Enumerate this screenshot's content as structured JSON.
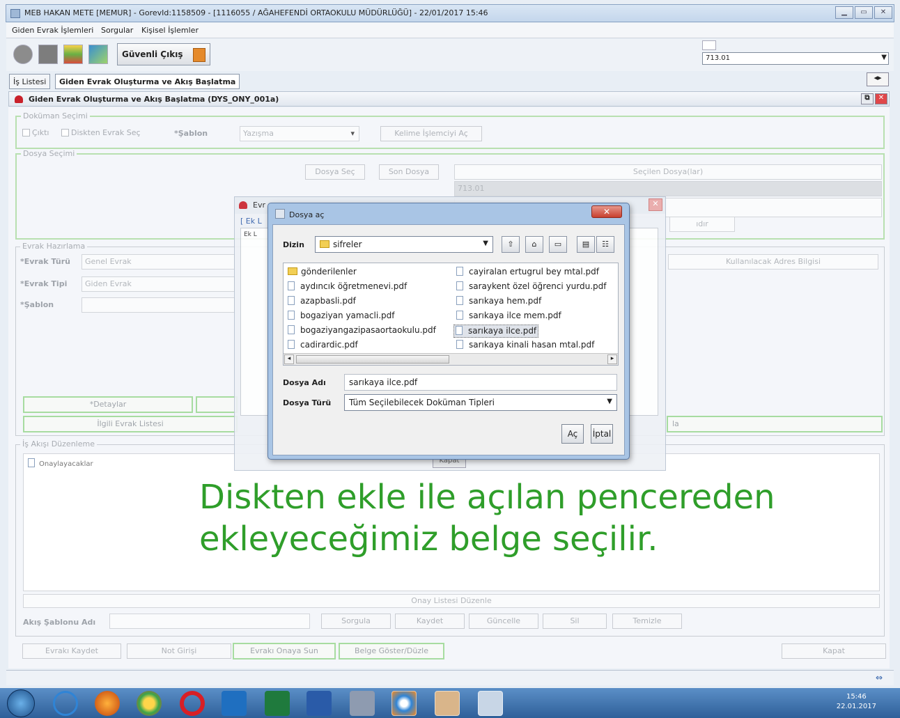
{
  "window": {
    "title": "MEB HAKAN METE [MEMUR] - GorevId:1158509 - [1116055 / AĞAHEFENDİ ORTAOKULU MÜDÜRLÜĞÜ] - 22/01/2017 15:46"
  },
  "menu": [
    "Giden Evrak İşlemleri",
    "Sorgular",
    "Kişisel İşlemler"
  ],
  "toolbar": {
    "safe_exit_label": "Güvenli Çıkış",
    "combo_value": "713.01"
  },
  "tabs": [
    "İş Listesi",
    "Giden Evrak Oluşturma ve Akış Başlatma"
  ],
  "form": {
    "header": "Giden Evrak Oluşturma ve Akış Başlatma (DYS_ONY_001a)",
    "document_selection": {
      "legend": "Doküman Seçimi",
      "check_new": "Çıktı",
      "check_disk": "Diskten Evrak Seç",
      "template_label": "*Şablon",
      "template_value": "Yazışma",
      "word_button": "Kelime İşlemciyi Aç"
    },
    "file_selection": {
      "legend": "Dosya Seçimi",
      "select_button": "Dosya Seç",
      "last_button": "Son Dosya",
      "selected_header": "Seçilen Dosya(lar)",
      "selected_value": "713.01"
    },
    "preparation": {
      "legend": "Evrak Hazırlama",
      "type_label": "*Evrak Türü",
      "type_value": "Genel Evrak",
      "kind_label": "*Evrak Tipi",
      "kind_value": "Giden Evrak",
      "template_label": "*Şablon",
      "address_header": "Kullanılacak Adres Bilgisi",
      "details_button": "*Detaylar",
      "related_button": "İlgili Evrak Listesi",
      "partial_label_1": "ıdır",
      "partial_label_2": "la"
    },
    "flow": {
      "legend": "İş Akışı Düzenleme",
      "tree_root": "Onaylayacaklar",
      "approval_edit": "Onay Listesi Düzenle",
      "template_name_label": "Akış Şablonu Adı",
      "buttons": [
        "Sorgula",
        "Kaydet",
        "Güncelle",
        "Sil",
        "Temizle"
      ]
    },
    "bottom_buttons": [
      "Evrakı Kaydet",
      "Not Girişi",
      "Evrakı Onaya Sun",
      "Belge Göster/Düzle",
      "Kapat"
    ]
  },
  "behind_dialog": {
    "title": "Evr",
    "tab": "[ Ek L",
    "tree": "Ek L",
    "close_button": "Kapat"
  },
  "open_dialog": {
    "title": "Dosya aç",
    "look_in_label": "Dizin",
    "look_in_value": "sifreler",
    "files_left": [
      {
        "name": "gönderilenler",
        "folder": true
      },
      {
        "name": "aydıncık öğretmenevi.pdf",
        "folder": false
      },
      {
        "name": "azapbasli.pdf",
        "folder": false
      },
      {
        "name": "bogaziyan yamacli.pdf",
        "folder": false
      },
      {
        "name": "bogaziyangazipasaortaokulu.pdf",
        "folder": false
      },
      {
        "name": "cadirardic.pdf",
        "folder": false
      }
    ],
    "files_right": [
      {
        "name": "cayiralan ertugrul bey mtal.pdf"
      },
      {
        "name": "saraykent özel öğrenci yurdu.pdf"
      },
      {
        "name": "sarıkaya hem.pdf"
      },
      {
        "name": "sarıkaya ilce mem.pdf"
      },
      {
        "name": "sarıkaya ilce.pdf"
      },
      {
        "name": "sarıkaya kinali hasan mtal.pdf"
      }
    ],
    "selected_file": "sarıkaya ilce.pdf",
    "filename_label": "Dosya Adı",
    "filename_value": "sarıkaya ilce.pdf",
    "filetype_label": "Dosya Türü",
    "filetype_value": "Tüm Seçilebilecek Doküman Tipleri",
    "open_button": "Aç",
    "cancel_button": "İptal"
  },
  "caption": {
    "line1": "Diskten ekle ile açılan pencereden",
    "line2": "ekleyeceğimiz belge seçilir."
  },
  "taskbar": {
    "time": "15:46",
    "date": "22.01.2017"
  }
}
